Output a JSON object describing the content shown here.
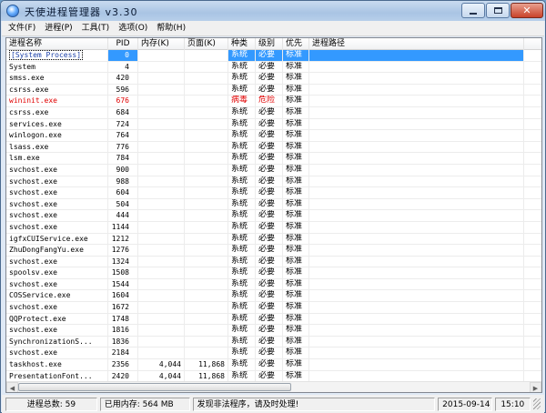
{
  "window": {
    "title": "天使进程管理器 v3.30"
  },
  "menu": [
    "文件(F)",
    "进程(P)",
    "工具(T)",
    "选项(O)",
    "帮助(H)"
  ],
  "columns": {
    "name": "进程名称",
    "pid": "PID",
    "mem": "内存(K)",
    "page": "页面(K)",
    "type": "种类",
    "level": "级别",
    "prio": "优先",
    "path": "进程路径"
  },
  "rows": [
    {
      "name": "[System Process]",
      "pid": "0",
      "mem": "",
      "page": "",
      "type": "系统",
      "level": "必要",
      "prio": "标准",
      "path": "",
      "selected": true
    },
    {
      "name": "System",
      "pid": "4",
      "mem": "",
      "page": "",
      "type": "系统",
      "level": "必要",
      "prio": "标准",
      "path": ""
    },
    {
      "name": "smss.exe",
      "pid": "420",
      "mem": "",
      "page": "",
      "type": "系统",
      "level": "必要",
      "prio": "标准",
      "path": ""
    },
    {
      "name": "csrss.exe",
      "pid": "596",
      "mem": "",
      "page": "",
      "type": "系统",
      "level": "必要",
      "prio": "标准",
      "path": ""
    },
    {
      "name": "wininit.exe",
      "pid": "676",
      "mem": "",
      "page": "",
      "type": "病毒",
      "level": "危险",
      "prio": "标准",
      "path": "",
      "danger": true
    },
    {
      "name": "csrss.exe",
      "pid": "684",
      "mem": "",
      "page": "",
      "type": "系统",
      "level": "必要",
      "prio": "标准",
      "path": ""
    },
    {
      "name": "services.exe",
      "pid": "724",
      "mem": "",
      "page": "",
      "type": "系统",
      "level": "必要",
      "prio": "标准",
      "path": ""
    },
    {
      "name": "winlogon.exe",
      "pid": "764",
      "mem": "",
      "page": "",
      "type": "系统",
      "level": "必要",
      "prio": "标准",
      "path": ""
    },
    {
      "name": "lsass.exe",
      "pid": "776",
      "mem": "",
      "page": "",
      "type": "系统",
      "level": "必要",
      "prio": "标准",
      "path": ""
    },
    {
      "name": "lsm.exe",
      "pid": "784",
      "mem": "",
      "page": "",
      "type": "系统",
      "level": "必要",
      "prio": "标准",
      "path": ""
    },
    {
      "name": "svchost.exe",
      "pid": "900",
      "mem": "",
      "page": "",
      "type": "系统",
      "level": "必要",
      "prio": "标准",
      "path": ""
    },
    {
      "name": "svchost.exe",
      "pid": "988",
      "mem": "",
      "page": "",
      "type": "系统",
      "level": "必要",
      "prio": "标准",
      "path": ""
    },
    {
      "name": "svchost.exe",
      "pid": "604",
      "mem": "",
      "page": "",
      "type": "系统",
      "level": "必要",
      "prio": "标准",
      "path": ""
    },
    {
      "name": "svchost.exe",
      "pid": "504",
      "mem": "",
      "page": "",
      "type": "系统",
      "level": "必要",
      "prio": "标准",
      "path": ""
    },
    {
      "name": "svchost.exe",
      "pid": "444",
      "mem": "",
      "page": "",
      "type": "系统",
      "level": "必要",
      "prio": "标准",
      "path": ""
    },
    {
      "name": "svchost.exe",
      "pid": "1144",
      "mem": "",
      "page": "",
      "type": "系统",
      "level": "必要",
      "prio": "标准",
      "path": ""
    },
    {
      "name": "igfxCUIService.exe",
      "pid": "1212",
      "mem": "",
      "page": "",
      "type": "系统",
      "level": "必要",
      "prio": "标准",
      "path": ""
    },
    {
      "name": "ZhuDongFangYu.exe",
      "pid": "1276",
      "mem": "",
      "page": "",
      "type": "系统",
      "level": "必要",
      "prio": "标准",
      "path": ""
    },
    {
      "name": "svchost.exe",
      "pid": "1324",
      "mem": "",
      "page": "",
      "type": "系统",
      "level": "必要",
      "prio": "标准",
      "path": ""
    },
    {
      "name": "spoolsv.exe",
      "pid": "1508",
      "mem": "",
      "page": "",
      "type": "系统",
      "level": "必要",
      "prio": "标准",
      "path": ""
    },
    {
      "name": "svchost.exe",
      "pid": "1544",
      "mem": "",
      "page": "",
      "type": "系统",
      "level": "必要",
      "prio": "标准",
      "path": ""
    },
    {
      "name": "COSService.exe",
      "pid": "1604",
      "mem": "",
      "page": "",
      "type": "系统",
      "level": "必要",
      "prio": "标准",
      "path": ""
    },
    {
      "name": "svchost.exe",
      "pid": "1672",
      "mem": "",
      "page": "",
      "type": "系统",
      "level": "必要",
      "prio": "标准",
      "path": ""
    },
    {
      "name": "QQProtect.exe",
      "pid": "1748",
      "mem": "",
      "page": "",
      "type": "系统",
      "level": "必要",
      "prio": "标准",
      "path": ""
    },
    {
      "name": "svchost.exe",
      "pid": "1816",
      "mem": "",
      "page": "",
      "type": "系统",
      "level": "必要",
      "prio": "标准",
      "path": ""
    },
    {
      "name": "SynchronizationS...",
      "pid": "1836",
      "mem": "",
      "page": "",
      "type": "系统",
      "level": "必要",
      "prio": "标准",
      "path": ""
    },
    {
      "name": "svchost.exe",
      "pid": "2184",
      "mem": "",
      "page": "",
      "type": "系统",
      "level": "必要",
      "prio": "标准",
      "path": ""
    },
    {
      "name": "taskhost.exe",
      "pid": "2356",
      "mem": "4,044",
      "page": "11,868",
      "type": "系统",
      "level": "必要",
      "prio": "标准",
      "path": ""
    },
    {
      "name": "PresentationFont...",
      "pid": "2420",
      "mem": "4,044",
      "page": "11,868",
      "type": "系统",
      "level": "必要",
      "prio": "标准",
      "path": ""
    }
  ],
  "status": {
    "count": "进程总数: 59",
    "memory": "已用内存: 564 MB",
    "message": "发现非法程序，请及时处理!",
    "date": "2015-09-14",
    "time": "15:10"
  },
  "colors": {
    "selection": "#3399ff",
    "danger": "#e00000"
  }
}
